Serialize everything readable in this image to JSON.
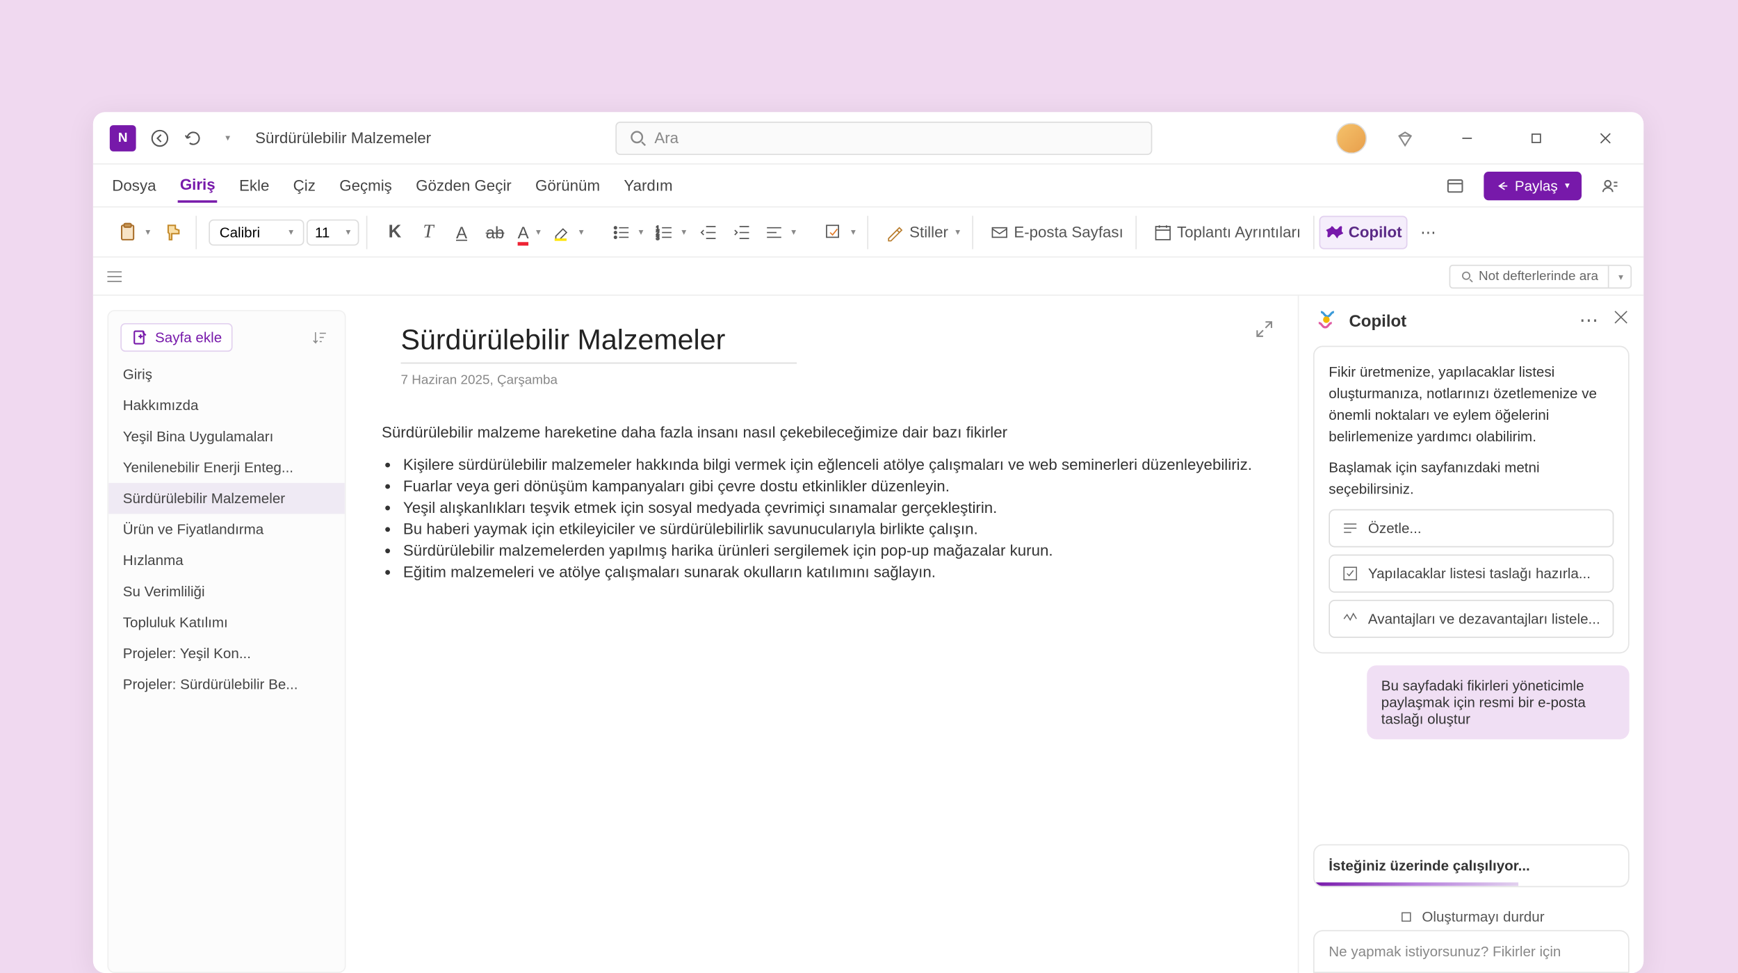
{
  "titlebar": {
    "doc_title": "Sürdürülebilir Malzemeler",
    "search_placeholder": "Ara"
  },
  "menubar": {
    "items": [
      "Dosya",
      "Giriş",
      "Ekle",
      "Çiz",
      "Geçmiş",
      "Gözden Geçir",
      "Görünüm",
      "Yardım"
    ],
    "active_index": 1,
    "share_label": "Paylaş"
  },
  "toolbar": {
    "font_name": "Calibri",
    "font_size": "11",
    "styles_label": "Stiller",
    "email_page_label": "E-posta Sayfası",
    "meeting_details_label": "Toplantı Ayrıntıları",
    "copilot_label": "Copilot"
  },
  "subtoolbar": {
    "notebook_search_placeholder": "Not defterlerinde ara"
  },
  "page_list": {
    "add_page_label": "Sayfa ekle",
    "items": [
      "Giriş",
      "Hakkımızda",
      "Yeşil Bina Uygulamaları",
      "Yenilenebilir Enerji Enteg...",
      "Sürdürülebilir Malzemeler",
      "Ürün ve Fiyatlandırma",
      "Hızlanma",
      "Su Verimliliği",
      "Topluluk Katılımı",
      "Projeler: Yeşil Kon...",
      "Projeler: Sürdürülebilir Be..."
    ],
    "active_index": 4
  },
  "note": {
    "title": "Sürdürülebilir Malzemeler",
    "date": "7 Haziran 2025, Çarşamba",
    "intro": "Sürdürülebilir malzeme hareketine daha fazla insanı nasıl çekebileceğimize dair bazı fikirler",
    "bullets": [
      "Kişilere sürdürülebilir malzemeler hakkında bilgi vermek için eğlenceli atölye çalışmaları ve web seminerleri düzenleyebiliriz.",
      "Fuarlar veya geri dönüşüm kampanyaları gibi çevre dostu etkinlikler düzenleyin.",
      "Yeşil alışkanlıkları teşvik etmek için sosyal medyada çevrimiçi sınamalar gerçekleştirin.",
      "Bu haberi yaymak için etkileyiciler ve sürdürülebilirlik savunucularıyla birlikte çalışın.",
      "Sürdürülebilir malzemelerden yapılmış harika ürünleri sergilemek için pop-up mağazalar kurun.",
      "Eğitim malzemeleri ve atölye çalışmaları sunarak okulların katılımını sağlayın."
    ]
  },
  "copilot": {
    "title": "Copilot",
    "intro_p1": "Fikir üretmenize, yapılacaklar listesi oluşturmanıza, notlarınızı özetlemenize ve önemli noktaları ve eylem öğelerini belirlemenize yardımcı olabilirim.",
    "intro_p2": "Başlamak için sayfanızdaki metni seçebilirsiniz.",
    "suggestions": [
      "Özetle...",
      "Yapılacaklar listesi taslağı hazırla...",
      "Avantajları ve dezavantajları listele..."
    ],
    "user_message": "Bu sayfadaki fikirleri yöneticimle paylaşmak için resmi bir e-posta taslağı oluştur",
    "working_label": "İsteğiniz üzerinde çalışılıyor...",
    "stop_label": "Oluşturmayı durdur",
    "input_placeholder": "Ne yapmak istiyorsunuz? Fikirler için"
  }
}
